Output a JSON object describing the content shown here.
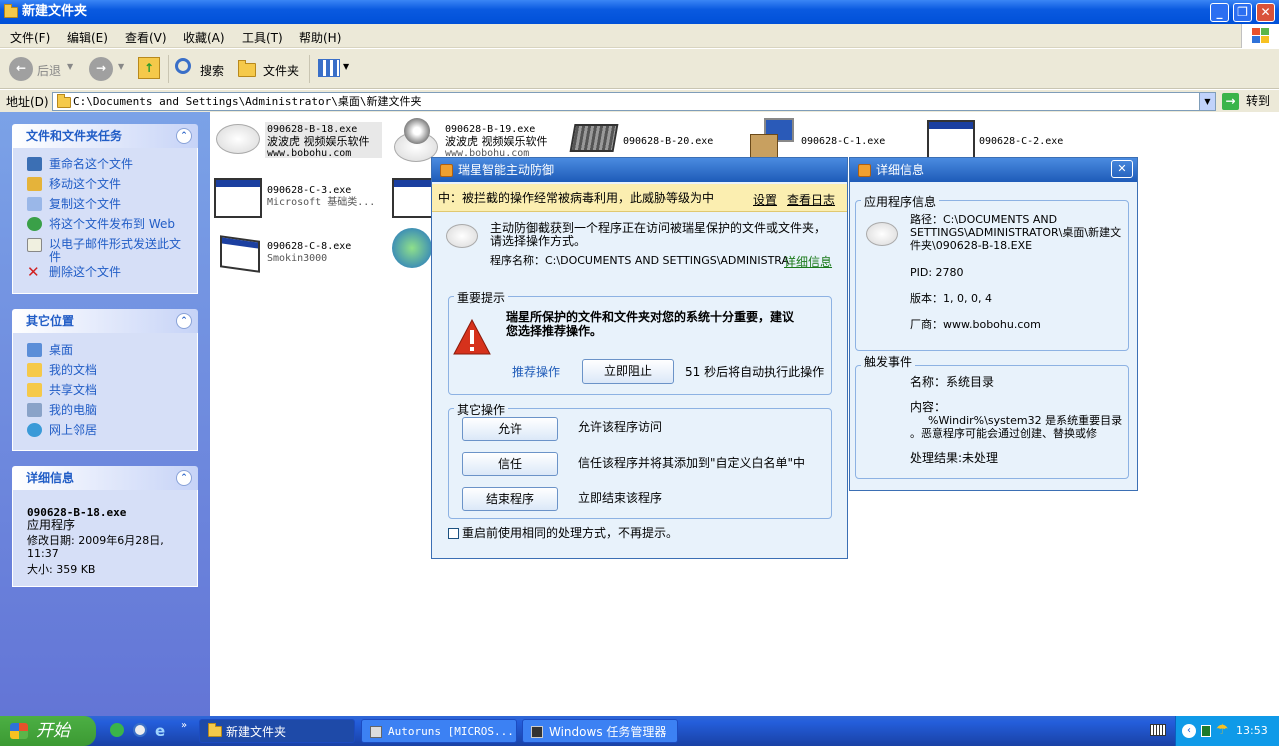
{
  "window": {
    "title": "新建文件夹"
  },
  "menu": [
    "文件(F)",
    "编辑(E)",
    "查看(V)",
    "收藏(A)",
    "工具(T)",
    "帮助(H)"
  ],
  "toolbar": {
    "back": "后退",
    "search": "搜索",
    "folders": "文件夹"
  },
  "address": {
    "label": "地址(D)",
    "value": "C:\\Documents and Settings\\Administrator\\桌面\\新建文件夹",
    "go": "转到"
  },
  "left_panel": {
    "file_tasks": {
      "title": "文件和文件夹任务",
      "items": [
        "重命名这个文件",
        "移动这个文件",
        "复制这个文件",
        "将这个文件发布到 Web",
        "以电子邮件形式发送此文件",
        "删除这个文件"
      ]
    },
    "other_places": {
      "title": "其它位置",
      "items": [
        "桌面",
        "我的文档",
        "共享文档",
        "我的电脑",
        "网上邻居"
      ]
    },
    "details": {
      "title": "详细信息",
      "filename": "090628-B-18.exe",
      "type": "应用程序",
      "modified_label": "修改日期: 2009年6月28日,",
      "modified_time": "11:37",
      "size": "大小: 359 KB"
    }
  },
  "files": [
    {
      "name": "090628-B-18.exe",
      "line2": "波波虎 视频娱乐软件",
      "line3": "www.bobohu.com"
    },
    {
      "name": "090628-B-19.exe",
      "line2": "波波虎 视频娱乐软件",
      "line3": "www.bobohu.com"
    },
    {
      "name": "090628-B-20.exe"
    },
    {
      "name": "090628-C-1.exe"
    },
    {
      "name": "090628-C-2.exe"
    },
    {
      "name": "090628-C-3.exe",
      "line2": "Microsoft 基础类..."
    },
    {
      "name": "090628-C-8.exe",
      "line2": "Smokin3000"
    }
  ],
  "rising_dialog": {
    "title": "瑞星智能主动防御",
    "warning": "中：被拦截的操作经常被病毒利用，此威胁等级为中",
    "settings": "设置",
    "view_log": "查看日志",
    "desc1": "主动防御截获到一个程序正在访问被瑞星保护的文件或文件夹，",
    "desc2": "请选择操作方式。",
    "program_label": "程序名称：C:\\DOCUMENTS AND SETTINGS\\ADMINISTRA",
    "details_link": "详细信息",
    "important_title": "重要提示",
    "important_text1": "瑞星所保护的文件和文件夹对您的系统十分重要，建议",
    "important_text2": "您选择推荐操作。",
    "recommended": "推荐操作",
    "block_button": "立即阻止",
    "countdown": "51 秒后将自动执行此操作",
    "other_title": "其它操作",
    "ops": [
      {
        "button": "允许",
        "desc": "允许该程序访问"
      },
      {
        "button": "信任",
        "desc": "信任该程序并将其添加到\"自定义白名单\"中"
      },
      {
        "button": "结束程序",
        "desc": "立即结束该程序"
      }
    ],
    "checkbox": "重启前使用相同的处理方式，不再提示。"
  },
  "details_dialog": {
    "title": "详细信息",
    "app_info": "应用程序信息",
    "path1": "路径：C:\\DOCUMENTS AND",
    "path2": "SETTINGS\\ADMINISTRATOR\\桌面\\新建文",
    "path3": "件夹\\090628-B-18.EXE",
    "pid": "PID: 2780",
    "version": "版本：1, 0, 0, 4",
    "vendor": "厂商：www.bobohu.com",
    "event": "触发事件",
    "ev_name": "名称：系统目录",
    "ev_content": "内容：",
    "ev_content1": "%Windir%\\system32 是系统重要目录",
    "ev_content2": "。恶意程序可能会通过创建、替换或修",
    "ev_result": "处理结果:未处理"
  },
  "taskbar": {
    "start": "开始",
    "tasks": [
      "新建文件夹",
      "Autoruns [MICROS...",
      "Windows 任务管理器"
    ],
    "clock": "13:53"
  }
}
